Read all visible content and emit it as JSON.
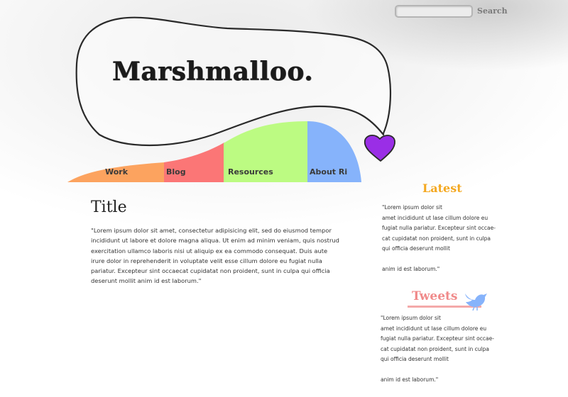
{
  "search": {
    "placeholder": "",
    "button_label": "Search"
  },
  "logo": {
    "text": "Marshmalloo."
  },
  "nav": {
    "items": [
      {
        "label": "Work",
        "color": "#fca35f"
      },
      {
        "label": "Blog",
        "color": "#fb7676"
      },
      {
        "label": "Resources",
        "color": "#bcfb82"
      },
      {
        "label": "About Ri",
        "color": "#86b3fb"
      }
    ]
  },
  "heart": {
    "icon": "heart-icon",
    "color": "#9a2ee6"
  },
  "main": {
    "title": "Title",
    "body": "\"Lorem ipsum dolor sit amet, consectetur adipisicing elit, sed do eiusmod tempor incididunt ut labore et dolore magna aliqua. Ut enim ad minim veniam, quis nostrud exercitation ullamco laboris nisi ut aliquip ex ea commodo consequat. Duis aute irure dolor in reprehenderit in voluptate velit esse cillum dolore eu fugiat nulla pariatur. Excepteur sint occaecat cupidatat non proident, sunt in culpa qui officia deserunt mollit anim id est laborum.\""
  },
  "sidebar": {
    "latest": {
      "heading": "Latest",
      "line1": "\"Lorem ipsum dolor sit",
      "line2": "amet incididunt ut lase cillum dolore eu",
      "line3": "fugiat nulla pariatur. Excepteur sint occae-",
      "line4": "cat cupidatat non proident, sunt in culpa",
      "line5": "qui officia deserunt mollit",
      "line6": "anim id est laborum.\"",
      "heading_color": "#f4a820"
    },
    "tweets": {
      "heading": "Tweets",
      "icon": "bird-icon",
      "line1": "\"Lorem ipsum dolor sit",
      "line2": "amet incididunt ut lase cillum dolore eu",
      "line3": "fugiat nulla pariatur. Excepteur sint occae-",
      "line4": "cat cupidatat non proident, sunt in culpa",
      "line5": "qui officia deserunt mollit",
      "line6": "anim id est laborum.\"",
      "heading_color": "#f08a8a"
    }
  }
}
